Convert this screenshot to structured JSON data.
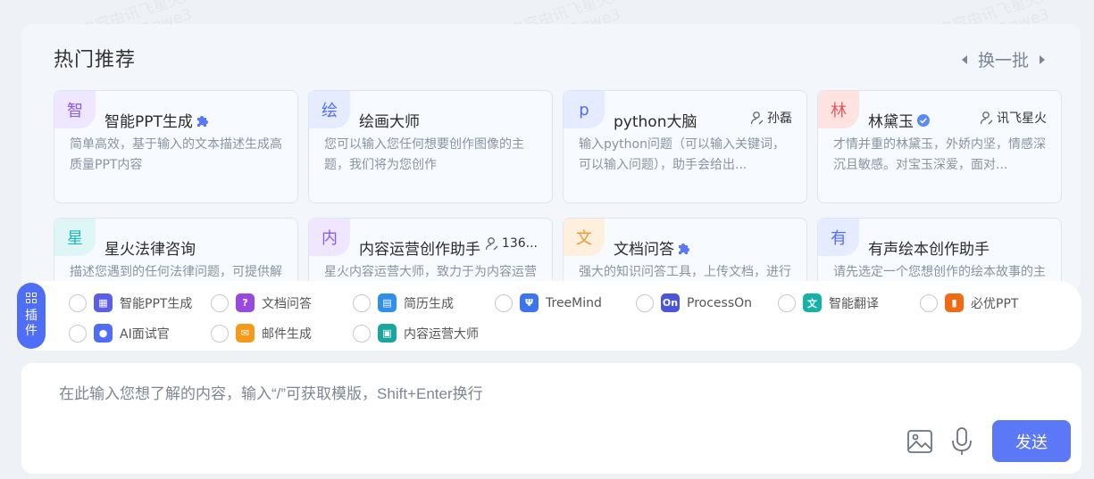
{
  "watermark": {
    "line1": "内容由讯飞星火AI生成",
    "line2": "2r9v9gf1qwe3"
  },
  "section": {
    "title": "热门推荐",
    "refresh_label": "换一批"
  },
  "cards": [
    {
      "badge": "智",
      "badge_bg": "#efe6ff",
      "badge_color": "#8b5cf6",
      "name": "智能PPT生成",
      "author": "",
      "desc": "简单高效，基于输入的文本描述生成高质量PPT内容",
      "icon": "puzzle-icon"
    },
    {
      "badge": "绘",
      "badge_bg": "#e5ecff",
      "badge_color": "#4f6ef7",
      "name": "绘画大师",
      "author": "",
      "desc": "您可以输入您任何想要创作图像的主题，我们将为您创作",
      "icon": ""
    },
    {
      "badge": "p",
      "badge_bg": "#e5ecff",
      "badge_color": "#4f6ef7",
      "name": "python大脑",
      "author": "孙磊",
      "desc": "输入python问题（可以输入关键词，可以输入问题），助手会给出...",
      "icon": ""
    },
    {
      "badge": "林",
      "badge_bg": "#ffe3e3",
      "badge_color": "#e05858",
      "name": "林黛玉",
      "author": "讯飞星火",
      "desc": "才情并重的林黛玉，外娇内坚，情感深沉且敏感。对宝玉深爱，面对...",
      "icon": "verified-icon"
    },
    {
      "badge": "星",
      "badge_bg": "#dff6f7",
      "badge_color": "#1fb5be",
      "name": "星火法律咨询",
      "author": "",
      "desc": "描述您遇到的任何法律问题，可提供解答和建议",
      "icon": ""
    },
    {
      "badge": "内",
      "badge_bg": "#efe6ff",
      "badge_color": "#8b5cf6",
      "name": "内容运营创作助手",
      "author": "136...",
      "desc": "星火内容运营大师，致力于为内容运营工作者提供专业、安全、可靠",
      "icon": ""
    },
    {
      "badge": "文",
      "badge_bg": "#fff0dd",
      "badge_color": "#f0962e",
      "name": "文档问答",
      "author": "",
      "desc": "强大的知识问答工具，上传文档，进行提问",
      "icon": "puzzle-icon"
    },
    {
      "badge": "有",
      "badge_bg": "#e5ecff",
      "badge_color": "#4f6ef7",
      "name": "有声绘本创作助手",
      "author": "",
      "desc": "请先选定一个您想创作的绘本故事的主题，然后输入你喜欢的画风，我...",
      "icon": ""
    }
  ],
  "plugins": {
    "tab_label_1": "插",
    "tab_label_2": "件",
    "items": [
      {
        "label": "智能PPT生成",
        "color": "#5b5fe8",
        "glyph": "▦"
      },
      {
        "label": "文档问答",
        "color": "#9b48e0",
        "glyph": "?"
      },
      {
        "label": "简历生成",
        "color": "#2f8fe9",
        "glyph": "▤"
      },
      {
        "label": "TreeMind",
        "color": "#3b74ee",
        "glyph": "Ψ"
      },
      {
        "label": "ProcessOn",
        "color": "#4a55d9",
        "glyph": "On"
      },
      {
        "label": "智能翻译",
        "color": "#16b1a8",
        "glyph": "文"
      },
      {
        "label": "必优PPT",
        "color": "#f06a16",
        "glyph": "▮"
      },
      {
        "label": "AI面试官",
        "color": "#4f6ef7",
        "glyph": "●"
      },
      {
        "label": "邮件生成",
        "color": "#f39a1b",
        "glyph": "✉"
      },
      {
        "label": "内容运营大师",
        "color": "#1aa6a0",
        "glyph": "▣"
      }
    ]
  },
  "input": {
    "placeholder": "在此输入您想了解的内容，输入“/”可获取模版，Shift+Enter换行",
    "send_label": "发送"
  }
}
